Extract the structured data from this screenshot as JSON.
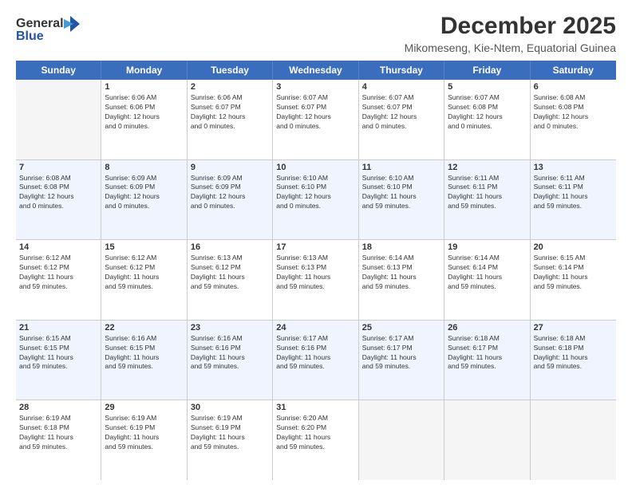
{
  "header": {
    "logo_line1": "General",
    "logo_line2": "Blue",
    "main_title": "December 2025",
    "sub_title": "Mikomeseng, Kie-Ntem, Equatorial Guinea"
  },
  "days_of_week": [
    "Sunday",
    "Monday",
    "Tuesday",
    "Wednesday",
    "Thursday",
    "Friday",
    "Saturday"
  ],
  "weeks": [
    [
      {
        "day": "",
        "info": ""
      },
      {
        "day": "1",
        "info": "Sunrise: 6:06 AM\nSunset: 6:06 PM\nDaylight: 12 hours\nand 0 minutes."
      },
      {
        "day": "2",
        "info": "Sunrise: 6:06 AM\nSunset: 6:07 PM\nDaylight: 12 hours\nand 0 minutes."
      },
      {
        "day": "3",
        "info": "Sunrise: 6:07 AM\nSunset: 6:07 PM\nDaylight: 12 hours\nand 0 minutes."
      },
      {
        "day": "4",
        "info": "Sunrise: 6:07 AM\nSunset: 6:07 PM\nDaylight: 12 hours\nand 0 minutes."
      },
      {
        "day": "5",
        "info": "Sunrise: 6:07 AM\nSunset: 6:08 PM\nDaylight: 12 hours\nand 0 minutes."
      },
      {
        "day": "6",
        "info": "Sunrise: 6:08 AM\nSunset: 6:08 PM\nDaylight: 12 hours\nand 0 minutes."
      }
    ],
    [
      {
        "day": "7",
        "info": "Sunrise: 6:08 AM\nSunset: 6:08 PM\nDaylight: 12 hours\nand 0 minutes."
      },
      {
        "day": "8",
        "info": "Sunrise: 6:09 AM\nSunset: 6:09 PM\nDaylight: 12 hours\nand 0 minutes."
      },
      {
        "day": "9",
        "info": "Sunrise: 6:09 AM\nSunset: 6:09 PM\nDaylight: 12 hours\nand 0 minutes."
      },
      {
        "day": "10",
        "info": "Sunrise: 6:10 AM\nSunset: 6:10 PM\nDaylight: 12 hours\nand 0 minutes."
      },
      {
        "day": "11",
        "info": "Sunrise: 6:10 AM\nSunset: 6:10 PM\nDaylight: 11 hours\nand 59 minutes."
      },
      {
        "day": "12",
        "info": "Sunrise: 6:11 AM\nSunset: 6:11 PM\nDaylight: 11 hours\nand 59 minutes."
      },
      {
        "day": "13",
        "info": "Sunrise: 6:11 AM\nSunset: 6:11 PM\nDaylight: 11 hours\nand 59 minutes."
      }
    ],
    [
      {
        "day": "14",
        "info": "Sunrise: 6:12 AM\nSunset: 6:12 PM\nDaylight: 11 hours\nand 59 minutes."
      },
      {
        "day": "15",
        "info": "Sunrise: 6:12 AM\nSunset: 6:12 PM\nDaylight: 11 hours\nand 59 minutes."
      },
      {
        "day": "16",
        "info": "Sunrise: 6:13 AM\nSunset: 6:12 PM\nDaylight: 11 hours\nand 59 minutes."
      },
      {
        "day": "17",
        "info": "Sunrise: 6:13 AM\nSunset: 6:13 PM\nDaylight: 11 hours\nand 59 minutes."
      },
      {
        "day": "18",
        "info": "Sunrise: 6:14 AM\nSunset: 6:13 PM\nDaylight: 11 hours\nand 59 minutes."
      },
      {
        "day": "19",
        "info": "Sunrise: 6:14 AM\nSunset: 6:14 PM\nDaylight: 11 hours\nand 59 minutes."
      },
      {
        "day": "20",
        "info": "Sunrise: 6:15 AM\nSunset: 6:14 PM\nDaylight: 11 hours\nand 59 minutes."
      }
    ],
    [
      {
        "day": "21",
        "info": "Sunrise: 6:15 AM\nSunset: 6:15 PM\nDaylight: 11 hours\nand 59 minutes."
      },
      {
        "day": "22",
        "info": "Sunrise: 6:16 AM\nSunset: 6:15 PM\nDaylight: 11 hours\nand 59 minutes."
      },
      {
        "day": "23",
        "info": "Sunrise: 6:16 AM\nSunset: 6:16 PM\nDaylight: 11 hours\nand 59 minutes."
      },
      {
        "day": "24",
        "info": "Sunrise: 6:17 AM\nSunset: 6:16 PM\nDaylight: 11 hours\nand 59 minutes."
      },
      {
        "day": "25",
        "info": "Sunrise: 6:17 AM\nSunset: 6:17 PM\nDaylight: 11 hours\nand 59 minutes."
      },
      {
        "day": "26",
        "info": "Sunrise: 6:18 AM\nSunset: 6:17 PM\nDaylight: 11 hours\nand 59 minutes."
      },
      {
        "day": "27",
        "info": "Sunrise: 6:18 AM\nSunset: 6:18 PM\nDaylight: 11 hours\nand 59 minutes."
      }
    ],
    [
      {
        "day": "28",
        "info": "Sunrise: 6:19 AM\nSunset: 6:18 PM\nDaylight: 11 hours\nand 59 minutes."
      },
      {
        "day": "29",
        "info": "Sunrise: 6:19 AM\nSunset: 6:19 PM\nDaylight: 11 hours\nand 59 minutes."
      },
      {
        "day": "30",
        "info": "Sunrise: 6:19 AM\nSunset: 6:19 PM\nDaylight: 11 hours\nand 59 minutes."
      },
      {
        "day": "31",
        "info": "Sunrise: 6:20 AM\nSunset: 6:20 PM\nDaylight: 11 hours\nand 59 minutes."
      },
      {
        "day": "",
        "info": ""
      },
      {
        "day": "",
        "info": ""
      },
      {
        "day": "",
        "info": ""
      }
    ]
  ]
}
